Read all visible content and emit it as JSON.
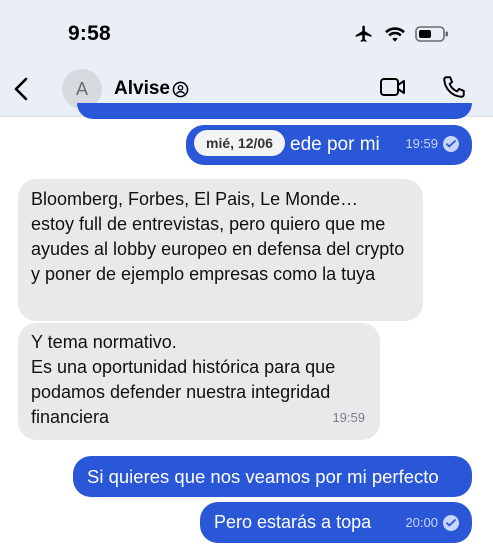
{
  "status_bar": {
    "time": "9:58",
    "icons": [
      "airplane-icon",
      "wifi-icon",
      "battery-icon"
    ]
  },
  "header": {
    "avatar_initial": "A",
    "contact_name": "Alvise",
    "icons": [
      "back-chevron-icon",
      "verified-icon",
      "video-call-icon",
      "phone-call-icon"
    ]
  },
  "date_separator": "mié, 12/06",
  "messages": [
    {
      "direction": "out",
      "text": "Si quieres que nos veamos puede por mi",
      "time": "19:59",
      "status": "read"
    },
    {
      "direction": "in",
      "text": "Bloomberg, Forbes, El Pais, Le Monde…\nestoy full de entrevistas, pero quiero que me ayudes al lobby europeo en defensa del crypto y poner de ejemplo empresas como la tuya"
    },
    {
      "direction": "in",
      "text": "Y tema normativo.\nEs una oportunidad histórica para que podamos defender nuestra integridad financiera",
      "time": "19:59"
    },
    {
      "direction": "out",
      "text": "Si quieres que nos veamos por mi perfecto"
    },
    {
      "direction": "out",
      "text": "Pero estarás a topa",
      "time": "20:00",
      "status": "read"
    }
  ],
  "visible_partial": {
    "msg0_visible_tail": "ede por mi"
  },
  "colors": {
    "outgoing_bubble": "#2a56d8",
    "incoming_bubble": "#e9e9eb",
    "header_bg": "#e9eef7"
  }
}
